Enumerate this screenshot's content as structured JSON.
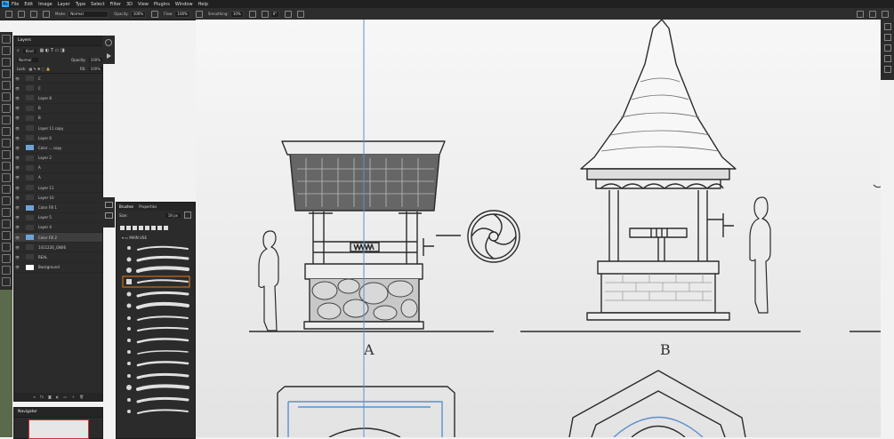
{
  "menu": [
    "File",
    "Edit",
    "Image",
    "Layer",
    "Type",
    "Select",
    "Filter",
    "3D",
    "View",
    "Plugins",
    "Window",
    "Help"
  ],
  "options": {
    "mode_label": "Mode:",
    "mode_value": "Normal",
    "opacity_label": "Opacity:",
    "opacity_value": "100%",
    "flow_label": "Flow:",
    "flow_value": "100%",
    "smoothing_label": "Smoothing:",
    "smoothing_value": "10%",
    "angle_value": "0°"
  },
  "layers_panel": {
    "tab": "Layers",
    "kind": "Kind",
    "blend": "Normal",
    "opacity_label": "Opacity:",
    "opacity_value": "100%",
    "lock_label": "Lock:",
    "fill_label": "Fill:",
    "fill_value": "100%",
    "rows": [
      "C",
      "C",
      "Layer 8",
      "B",
      "B",
      "Layer 11 copy",
      "Layer 6",
      "Color ... copy",
      "Layer 2",
      "A",
      "A",
      "Layer 11",
      "Layer 10",
      "Color Fill 1",
      "Layer 5",
      "Layer 4",
      "Color Fill 2",
      "1411226_GN06",
      "REAL",
      "Background"
    ]
  },
  "navigator": {
    "tab": "Navigator"
  },
  "brushes_panel": {
    "tab_brushes": "Brushes",
    "tab_properties": "Properties",
    "size_label": "Size:",
    "size_value": "18 px",
    "folder": "MAIN USE"
  },
  "canvas": {
    "label_a": "A",
    "label_b": "B"
  },
  "colors": {
    "ui_dark": "#2b2b2b",
    "accent": "#31a8ff",
    "guide": "#5b8fd0",
    "ink": "#2a2a2a"
  }
}
